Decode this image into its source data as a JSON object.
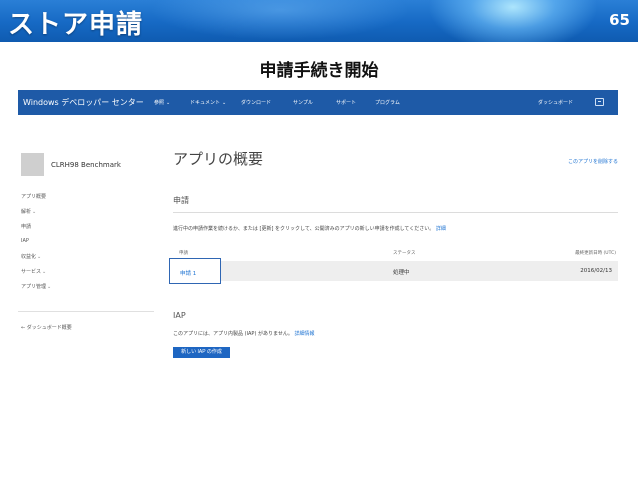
{
  "slide": {
    "title": "ストア申請",
    "page_number": "65",
    "subtitle": "申請手続き開始"
  },
  "topnav": {
    "brand": "Windows デベロッパー センター",
    "items": [
      {
        "label": "参照",
        "has_dropdown": true
      },
      {
        "label": "ドキュメント",
        "has_dropdown": true
      },
      {
        "label": "ダウンロード",
        "has_dropdown": false
      },
      {
        "label": "サンプル",
        "has_dropdown": false
      },
      {
        "label": "サポート",
        "has_dropdown": false
      },
      {
        "label": "プログラム",
        "has_dropdown": false
      }
    ],
    "dashboard": "ダッシュボード",
    "feedback_icon": "feedback-icon"
  },
  "sidebar": {
    "app_name": "CLRH98 Benchmark",
    "items": [
      {
        "label": "アプリ概要",
        "has_dropdown": false
      },
      {
        "label": "解析",
        "has_dropdown": true
      },
      {
        "label": "申請",
        "has_dropdown": false
      },
      {
        "label": "IAP",
        "has_dropdown": false
      },
      {
        "label": "収益化",
        "has_dropdown": true
      },
      {
        "label": "サービス",
        "has_dropdown": true
      },
      {
        "label": "アプリ管理",
        "has_dropdown": true
      }
    ],
    "back_link": "← ダッシュボード概要"
  },
  "main": {
    "title": "アプリの概要",
    "top_link": "このアプリを削除する",
    "submissions": {
      "heading": "申請",
      "description": "進行中の申請作業を続けるか、または [更新] をクリックして、公開済みのアプリの新しい申請を作成してください。",
      "description_link": "詳細",
      "columns": [
        "申請",
        "ステータス",
        "最終更新日時 (UTC)"
      ],
      "rows": [
        {
          "name": "申請 1",
          "status": "処理中",
          "updated": "2016/02/13"
        }
      ]
    },
    "iap": {
      "heading": "IAP",
      "description": "このアプリには、アプリ内製品 (IAP) がありません。",
      "description_link": "詳細情報",
      "button": "新しい IAP の作成"
    }
  },
  "colors": {
    "header_blue": "#1669c4",
    "nav_blue": "#1e5aa7",
    "link_blue": "#1e73d2",
    "highlight_border": "#2f66b3"
  }
}
